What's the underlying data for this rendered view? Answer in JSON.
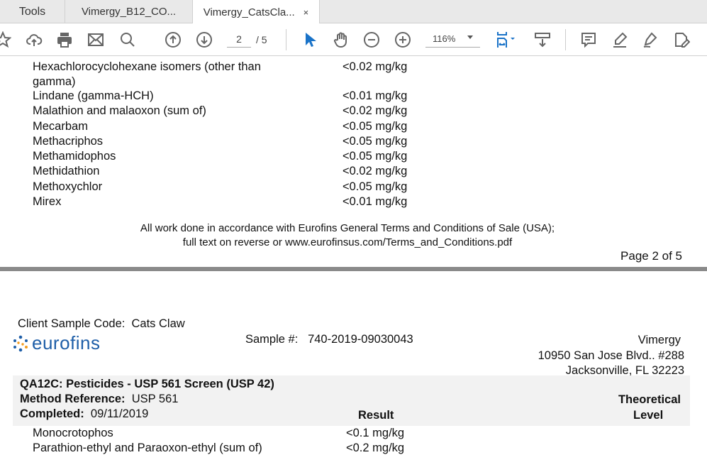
{
  "tabs": [
    {
      "label": "Tools"
    },
    {
      "label": "Vimergy_B12_CO..."
    },
    {
      "label": "Vimergy_CatsCla...",
      "close": "×"
    }
  ],
  "toolbar": {
    "page_current": "2",
    "page_total": "/ 5",
    "zoom": "116%",
    "icons": [
      "star-icon",
      "cloud-upload-icon",
      "print-icon",
      "mail-icon",
      "search-icon",
      "page-up-icon",
      "page-down-icon",
      "select-pointer-icon",
      "hand-icon",
      "zoom-out-icon",
      "zoom-in-icon",
      "fit-page-icon",
      "scroll-mode-icon",
      "comment-icon",
      "highlight-icon",
      "sign-icon",
      "edit-pdf-icon"
    ]
  },
  "page2": {
    "rows": [
      {
        "name": "Hexachlorocyclohexane isomers (other than",
        "name2": "gamma)",
        "value": "<0.02 mg/kg"
      },
      {
        "name": "Lindane (gamma-HCH)",
        "value": "<0.01 mg/kg"
      },
      {
        "name": "Malathion and malaoxon (sum of)",
        "value": "<0.02 mg/kg"
      },
      {
        "name": "Mecarbam",
        "value": "<0.05 mg/kg"
      },
      {
        "name": "Methacriphos",
        "value": "<0.05 mg/kg"
      },
      {
        "name": "Methamidophos",
        "value": "<0.05 mg/kg"
      },
      {
        "name": "Methidathion",
        "value": "<0.02 mg/kg"
      },
      {
        "name": "Methoxychlor",
        "value": "<0.05 mg/kg"
      },
      {
        "name": "Mirex",
        "value": "<0.01 mg/kg"
      }
    ],
    "footer1": "All work done in accordance with Eurofins General Terms and Conditions of Sale (USA);",
    "footer2": "full text on reverse or www.eurofinsus.com/Terms_and_Conditions.pdf",
    "page_label": "Page 2 of 5"
  },
  "page3": {
    "client_label": "Client Sample Code:",
    "client_value": "Cats Claw",
    "logo": "eurofins",
    "sample_label": "Sample #:",
    "sample_value": "740-2019-09030043",
    "address": [
      "Vimergy",
      "10950 San Jose Blvd.. #288",
      "Jacksonville, FL 32223"
    ],
    "test_title": "QA12C: Pesticides - USP 561 Screen (USP 42)",
    "method_label": "Method Reference:",
    "method_value": "USP 561",
    "completed_label": "Completed:",
    "completed_value": "09/11/2019",
    "col_result": "Result",
    "col_theoretical": "Theoretical",
    "col_level": "Level",
    "rows": [
      {
        "name": "Monocrotophos",
        "value": "<0.1 mg/kg"
      },
      {
        "name": "Parathion-ethyl and Paraoxon-ethyl (sum of)",
        "value": "<0.2 mg/kg"
      }
    ]
  }
}
